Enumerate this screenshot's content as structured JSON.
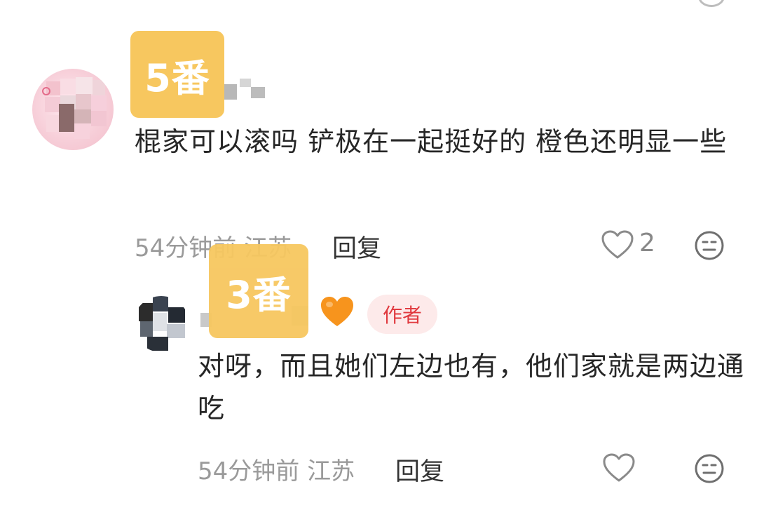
{
  "comments": [
    {
      "badge": "5番",
      "text": "棍家可以滚吗 铲极在一起挺好的 橙色还明显一些",
      "time": "54分钟前",
      "location": "江苏",
      "reply_label": "回复",
      "like_count": "2"
    },
    {
      "badge": "3番",
      "author_tag": "作者",
      "text": "对呀，而且她们左边也有，他们家就是两边通吃",
      "time": "54分钟前",
      "location": "江苏",
      "reply_label": "回复"
    }
  ],
  "colors": {
    "badge": "#f7c75f",
    "author_tag_bg": "#fdeaea",
    "author_tag_text": "#e0393e",
    "meta_text": "#9a9a9a"
  },
  "icons": [
    "heart-outline-icon",
    "emoji-icon",
    "orange-heart-icon"
  ]
}
